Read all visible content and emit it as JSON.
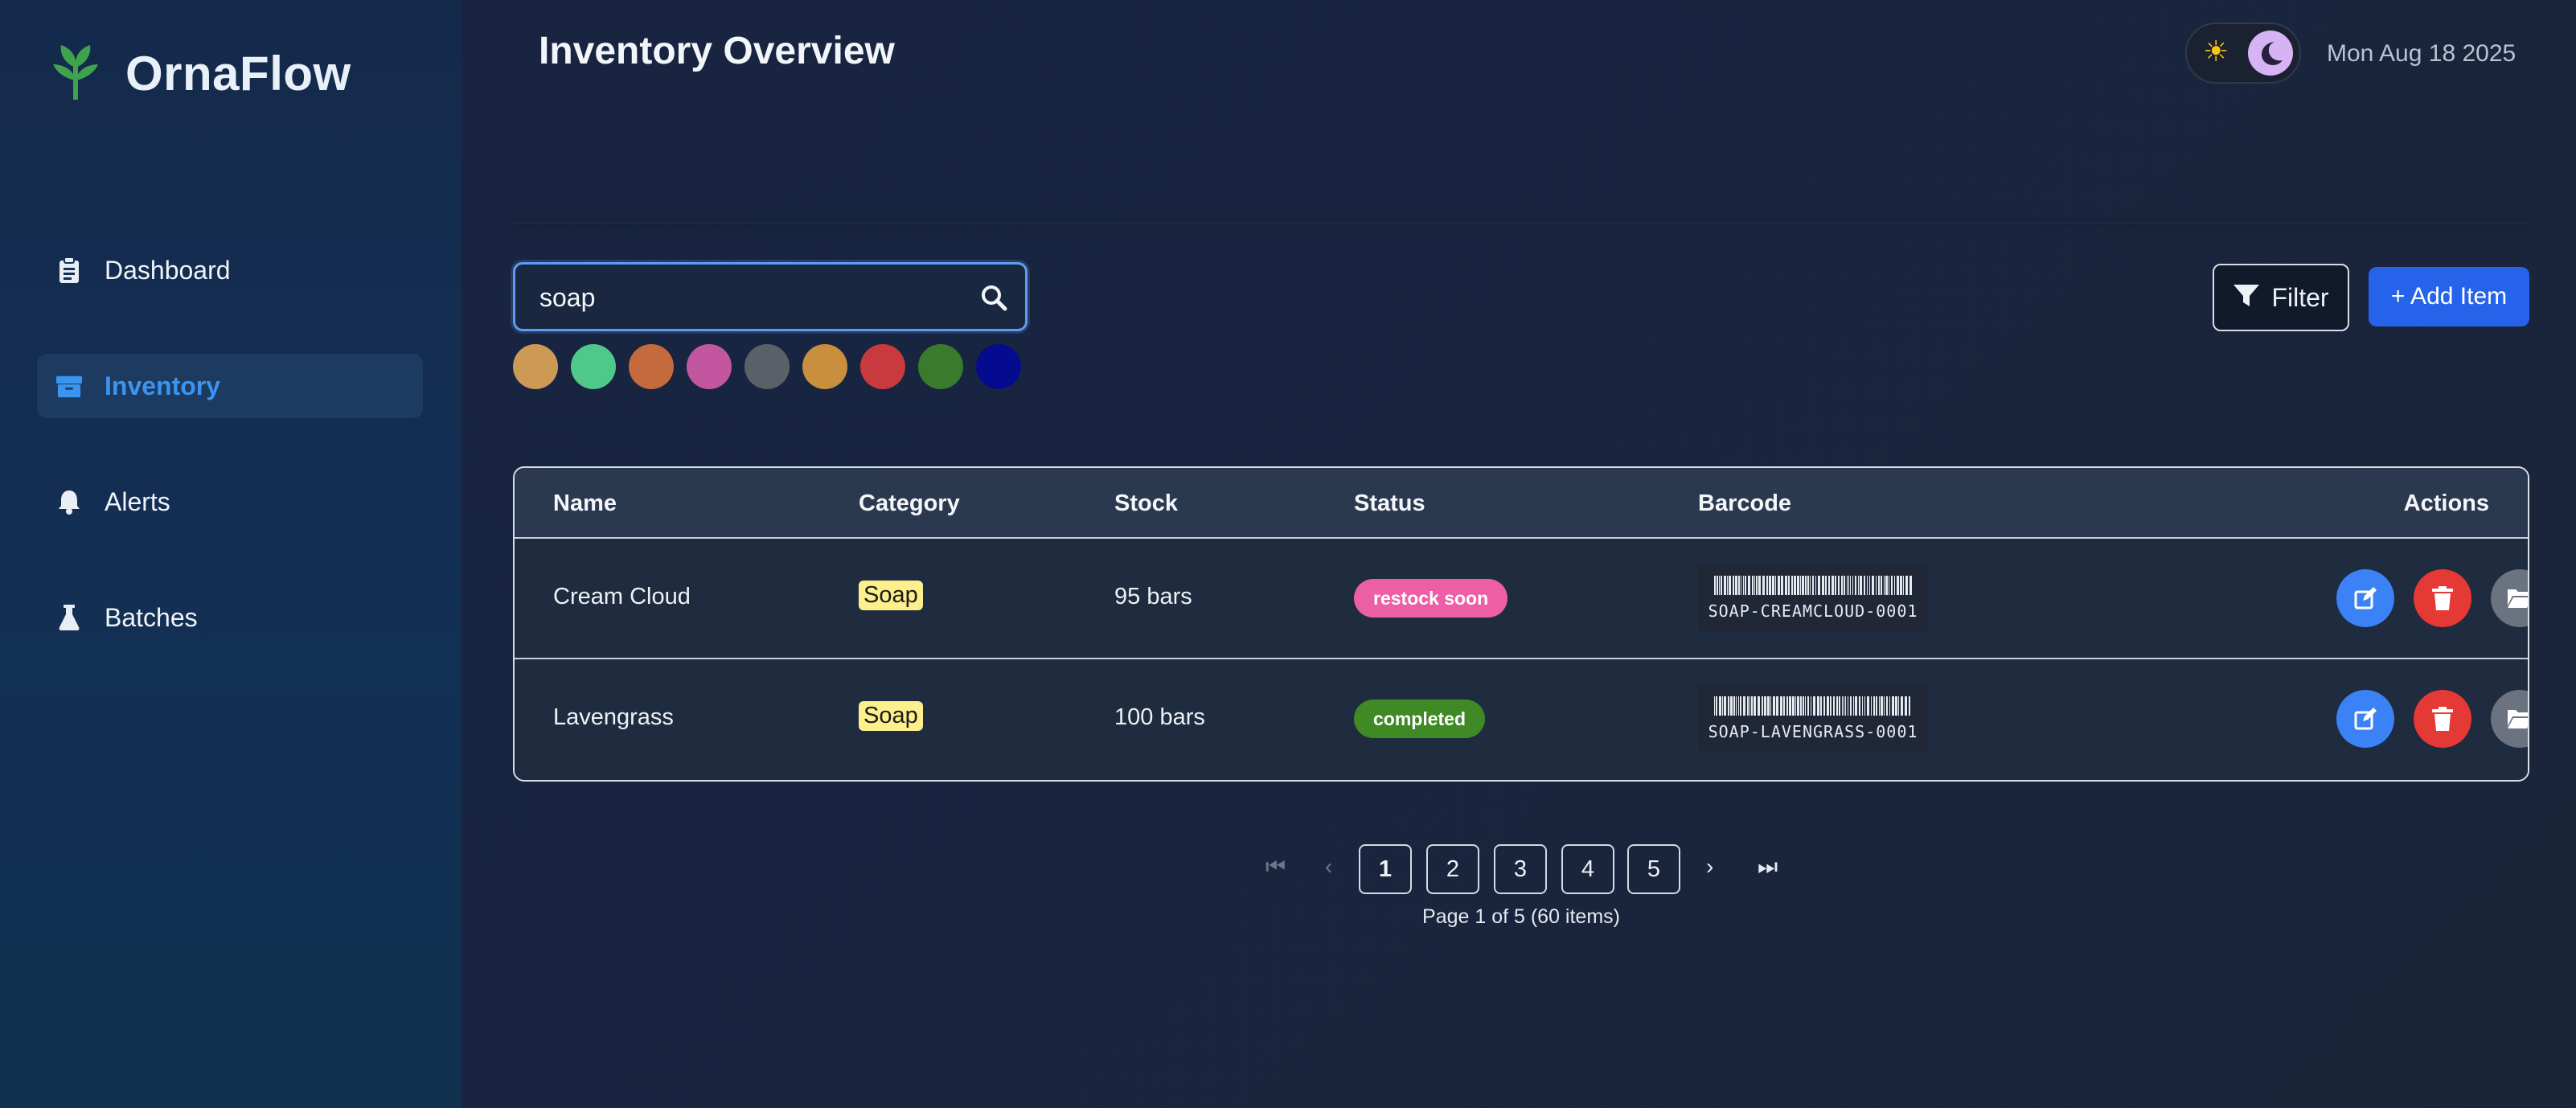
{
  "app": {
    "name": "OrnaFlow"
  },
  "sidebar": {
    "items": [
      {
        "label": "Dashboard",
        "icon": "clipboard-icon",
        "active": false
      },
      {
        "label": "Inventory",
        "icon": "box-icon",
        "active": true
      },
      {
        "label": "Alerts",
        "icon": "bell-icon",
        "active": false
      },
      {
        "label": "Batches",
        "icon": "flask-icon",
        "active": false
      }
    ]
  },
  "header": {
    "title": "Inventory Overview",
    "date": "Mon Aug 18 2025",
    "theme": "dark"
  },
  "search": {
    "value": "soap",
    "placeholder": ""
  },
  "color_filters": [
    "#cc9a55",
    "#4fc98a",
    "#c56a3c",
    "#c257a0",
    "#5b6068",
    "#c98e3e",
    "#c83a3d",
    "#3a7a2c",
    "#050b8e"
  ],
  "toolbar": {
    "filter_label": "Filter",
    "add_label": "+ Add Item"
  },
  "table": {
    "columns": [
      "Name",
      "Category",
      "Stock",
      "Status",
      "Barcode",
      "Actions"
    ],
    "rows": [
      {
        "name": "Cream Cloud",
        "category": "Soap",
        "stock": "95 bars",
        "status": "restock soon",
        "status_color": "#ec5fa6",
        "barcode": "SOAP-CREAMCLOUD-0001"
      },
      {
        "name": "Lavengrass",
        "category": "Soap",
        "stock": "100 bars",
        "status": "completed",
        "status_color": "#3f8a25",
        "barcode": "SOAP-LAVENGRASS-0001"
      }
    ]
  },
  "pagination": {
    "pages": [
      "1",
      "2",
      "3",
      "4",
      "5"
    ],
    "current": "1",
    "first_symbol": "⏮",
    "prev_symbol": "‹",
    "next_symbol": "›",
    "last_symbol": "⏭",
    "info": "Page 1 of 5 (60 items)"
  },
  "colors": {
    "accent": "#2563eb",
    "edit": "#3b82f6",
    "delete": "#e53935",
    "archive": "#6b7280",
    "brand_leaf": "#3fa34d"
  }
}
